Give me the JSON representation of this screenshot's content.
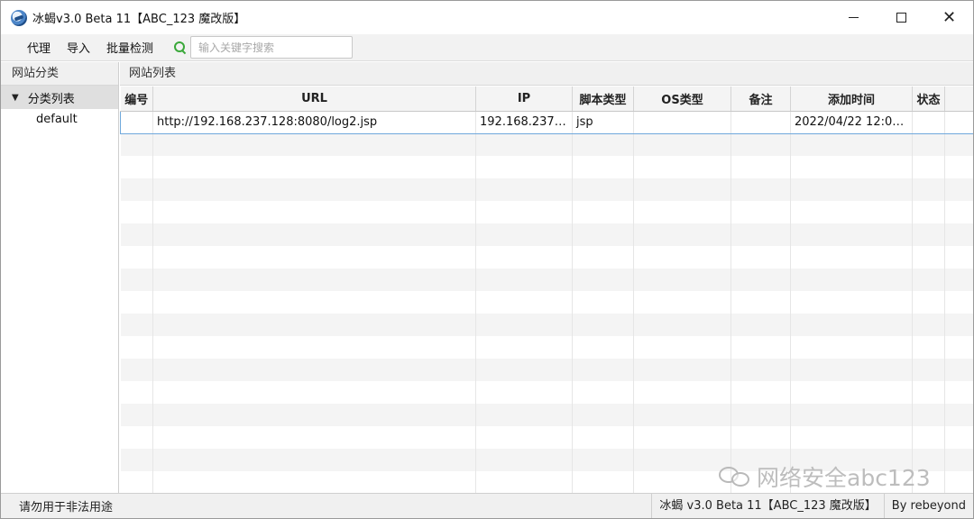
{
  "window": {
    "title": "冰蝎v3.0 Beta 11【ABC_123 魔改版】",
    "icon": "app-globe-icon"
  },
  "menu": {
    "items": [
      "代理",
      "导入",
      "批量检测"
    ],
    "search_placeholder": "输入关键字搜索",
    "search_value": ""
  },
  "left_pane": {
    "header": "网站分类",
    "tree": {
      "root_label": "分类列表",
      "expanded": true,
      "children": [
        "default"
      ]
    }
  },
  "right_pane": {
    "header": "网站列表",
    "columns": [
      "编号",
      "URL",
      "IP",
      "脚本类型",
      "OS类型",
      "备注",
      "添加时间",
      "状态"
    ],
    "rows": [
      {
        "id": "",
        "url": "http://192.168.237.128:8080/log2.jsp",
        "ip": "192.168.237.1...",
        "script_type": "jsp",
        "os_type": "",
        "note": "",
        "added_time": "2022/04/22 12:07...",
        "status": ""
      }
    ],
    "selected_row": 0
  },
  "status_bar": {
    "left": "请勿用于非法用途",
    "version": "冰蝎 v3.0 Beta 11【ABC_123 魔改版】",
    "author": "By rebeyond"
  },
  "watermark": {
    "text": "网络安全abc123",
    "icon": "wechat-icon"
  },
  "colors": {
    "selection_border": "#6fa8dc",
    "search_icon": "#3aa83a"
  }
}
